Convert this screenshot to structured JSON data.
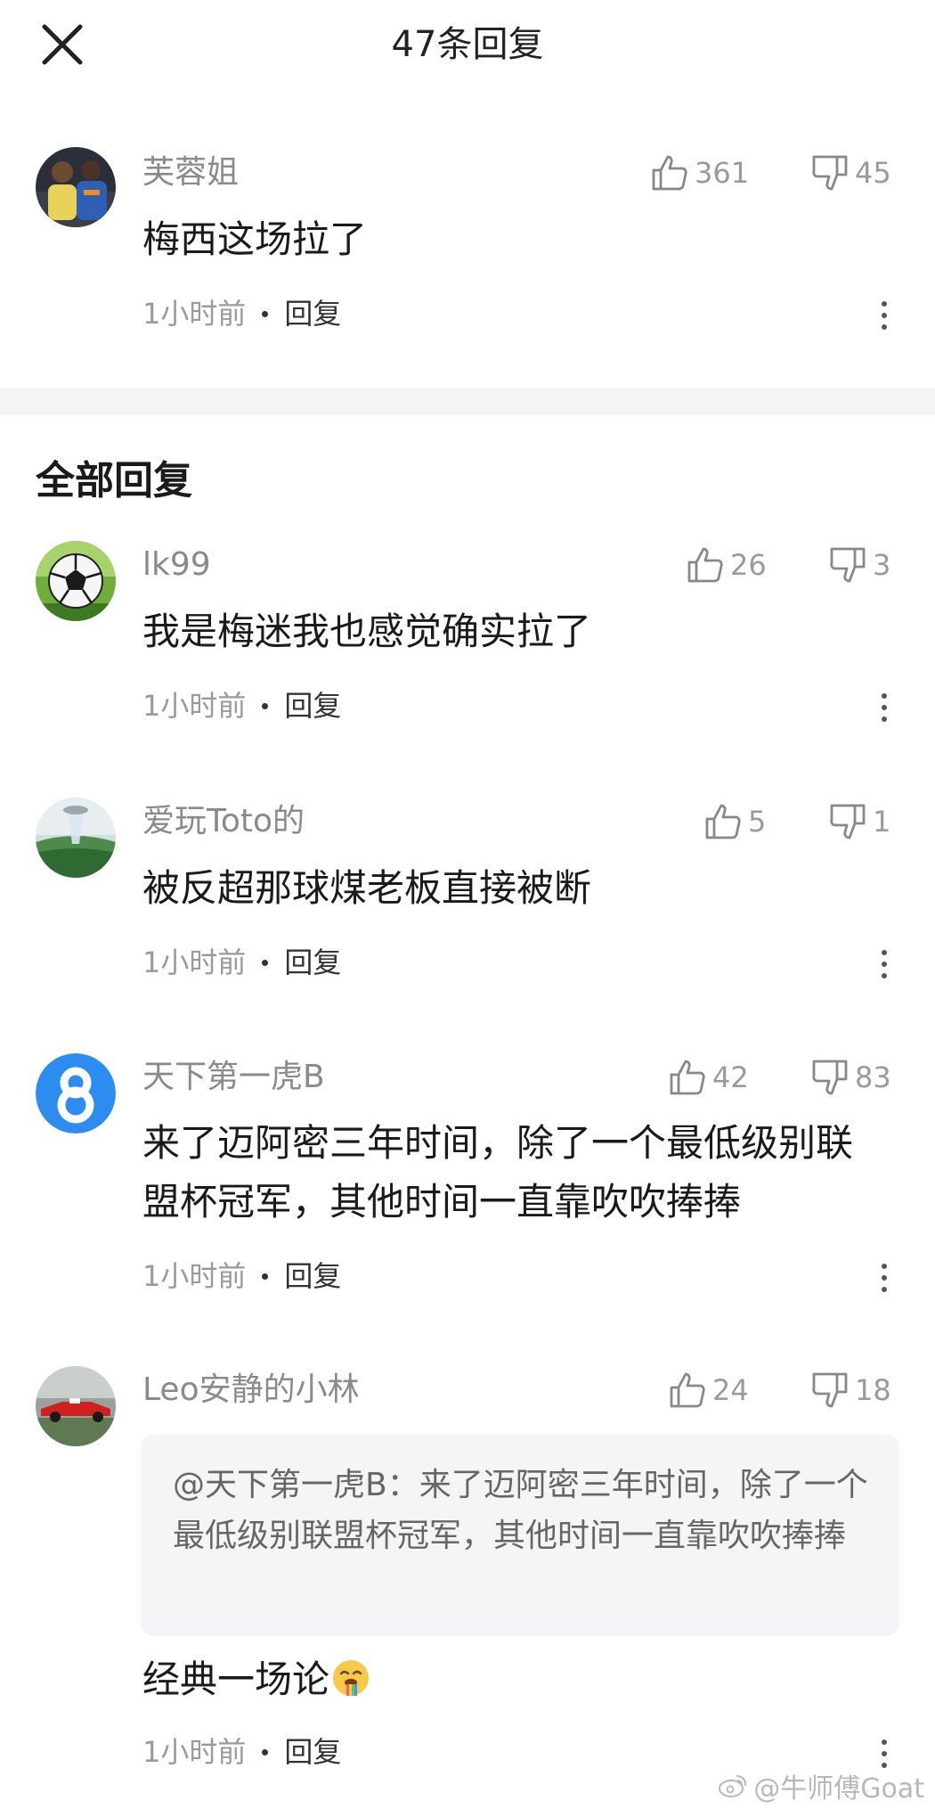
{
  "header": {
    "title": "47条回复"
  },
  "top_comment": {
    "username": "芙蓉姐",
    "likes": "361",
    "dislikes": "45",
    "text": "梅西这场拉了",
    "time": "1小时前",
    "reply_label": "回复"
  },
  "section_title": "全部回复",
  "replies": [
    {
      "username": "lk99",
      "likes": "26",
      "dislikes": "3",
      "text": "我是梅迷我也感觉确实拉了",
      "time": "1小时前",
      "reply_label": "回复"
    },
    {
      "username": "爱玩Toto的",
      "likes": "5",
      "dislikes": "1",
      "text": "被反超那球煤老板直接被断",
      "time": "1小时前",
      "reply_label": "回复"
    },
    {
      "username": "天下第一虎B",
      "likes": "42",
      "dislikes": "83",
      "text": "来了迈阿密三年时间，除了一个最低级别联盟杯冠军，其他时间一直靠吹吹捧捧",
      "time": "1小时前",
      "reply_label": "回复"
    },
    {
      "username": "Leo安静的小林",
      "likes": "24",
      "dislikes": "18",
      "quote": "@天下第一虎B：来了迈阿密三年时间，除了一个最低级别联盟杯冠军，其他时间一直靠吹吹捧捧",
      "text": "经典一场论",
      "time": "1小时前",
      "reply_label": "回复"
    }
  ],
  "watermark": "@牛师傅Goat",
  "icons": {
    "close": "close-icon",
    "like": "thumbs-up-icon",
    "dislike": "thumbs-down-icon",
    "more": "more-vertical-icon",
    "emoji": "drooling-face-emoji",
    "weibo": "weibo-logo-icon"
  },
  "colors": {
    "username": "#8a8a8a",
    "meta": "#9a9a9a",
    "divider": "#f3f4f6",
    "quote_bg": "#f4f5f7",
    "avatar_8_blue": "#2d8cf0"
  }
}
